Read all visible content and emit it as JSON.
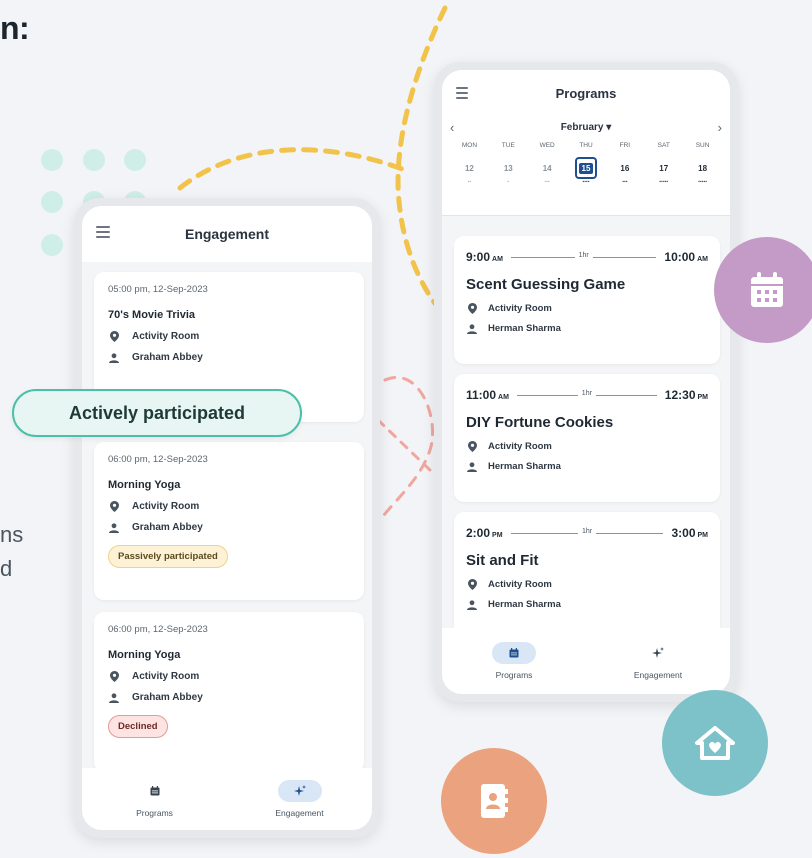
{
  "marketing": {
    "headline_fragment": "n:",
    "body_line_1": "ns",
    "body_line_2": "d"
  },
  "engagement_screen": {
    "title": "Engagement",
    "cards": [
      {
        "datetime": "05:00 pm, 12-Sep-2023",
        "name": "70's Movie Trivia",
        "location": "Activity Room",
        "person": "Graham Abbey",
        "status": "Actively participated"
      },
      {
        "datetime": "06:00 pm, 12-Sep-2023",
        "name": "Morning Yoga",
        "location": "Activity Room",
        "person": "Graham Abbey",
        "status": "Passively participated"
      },
      {
        "datetime": "06:00 pm, 12-Sep-2023",
        "name": "Morning Yoga",
        "location": "Activity Room",
        "person": "Graham Abbey",
        "status": "Declined"
      }
    ],
    "nav": [
      {
        "label": "Programs",
        "icon": "calendar-icon",
        "active": false
      },
      {
        "label": "Engagement",
        "icon": "sparkle-icon",
        "active": true
      }
    ]
  },
  "callout": {
    "text": "Actively participated",
    "color": "#4bbfa9"
  },
  "programs_screen": {
    "title": "Programs",
    "month": "February",
    "day_names": [
      "MON",
      "TUE",
      "WED",
      "THU",
      "FRI",
      "SAT",
      "SUN"
    ],
    "day_numbers": [
      "12",
      "13",
      "14",
      "15",
      "16",
      "17",
      "18"
    ],
    "selected_day": "15",
    "programs": [
      {
        "start": "9:00",
        "start_ampm": "AM",
        "duration": "1hr",
        "end": "10:00",
        "end_ampm": "AM",
        "name": "Scent Guessing Game",
        "location": "Activity Room",
        "person": "Herman Sharma"
      },
      {
        "start": "11:00",
        "start_ampm": "AM",
        "duration": "1hr",
        "end": "12:30",
        "end_ampm": "PM",
        "name": "DIY Fortune Cookies",
        "location": "Activity Room",
        "person": "Herman Sharma"
      },
      {
        "start": "2:00",
        "start_ampm": "PM",
        "duration": "1hr",
        "end": "3:00",
        "end_ampm": "PM",
        "name": "Sit and Fit",
        "location": "Activity Room",
        "person": "Herman Sharma"
      }
    ],
    "nav": [
      {
        "label": "Programs",
        "icon": "calendar-icon",
        "active": true
      },
      {
        "label": "Engagement",
        "icon": "sparkle-icon",
        "active": false
      }
    ]
  },
  "colors": {
    "accent_blue": "#1d4f91",
    "teal": "#4bbfa9",
    "purple_bubble": "#c49ac6",
    "teal_bubble": "#7dc2c9",
    "orange_bubble": "#eba27e",
    "yellow_dash": "#f2c34b",
    "pink_dash": "#f0a7a0"
  },
  "decorative_icons": [
    "calendar-icon",
    "home-heart-icon",
    "contact-book-icon"
  ]
}
